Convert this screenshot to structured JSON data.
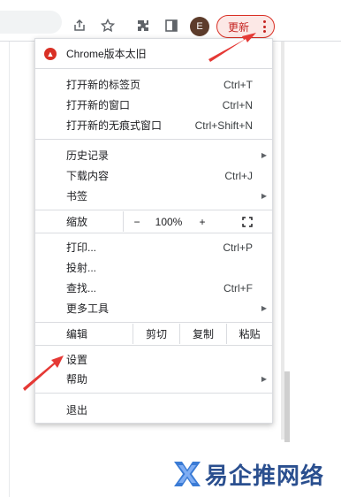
{
  "toolbar": {
    "avatar_letter": "E",
    "update_label": "更新",
    "icons": [
      "share-icon",
      "bookmark-star-icon",
      "extensions-icon",
      "side-panel-icon",
      "more-vert-icon"
    ]
  },
  "menu": {
    "update_item": "Chrome版本太旧",
    "new_tab": {
      "label": "打开新的标签页",
      "shortcut": "Ctrl+T"
    },
    "new_window": {
      "label": "打开新的窗口",
      "shortcut": "Ctrl+N"
    },
    "new_incognito": {
      "label": "打开新的无痕式窗口",
      "shortcut": "Ctrl+Shift+N"
    },
    "history": {
      "label": "历史记录"
    },
    "downloads": {
      "label": "下载内容",
      "shortcut": "Ctrl+J"
    },
    "bookmarks": {
      "label": "书签"
    },
    "zoom": {
      "label": "缩放",
      "minus": "−",
      "value": "100%",
      "plus": "+"
    },
    "print": {
      "label": "打印...",
      "shortcut": "Ctrl+P"
    },
    "cast": {
      "label": "投射..."
    },
    "find": {
      "label": "查找...",
      "shortcut": "Ctrl+F"
    },
    "more_tools": {
      "label": "更多工具"
    },
    "edit": {
      "label": "编辑",
      "cut": "剪切",
      "copy": "复制",
      "paste": "粘贴"
    },
    "settings": {
      "label": "设置"
    },
    "help": {
      "label": "帮助"
    },
    "exit": {
      "label": "退出"
    }
  },
  "watermark": {
    "text": "易企推网络"
  },
  "colors": {
    "accent_red": "#d93025",
    "arrow_red": "#e53935",
    "watermark_blue": "#2a4f8f"
  }
}
